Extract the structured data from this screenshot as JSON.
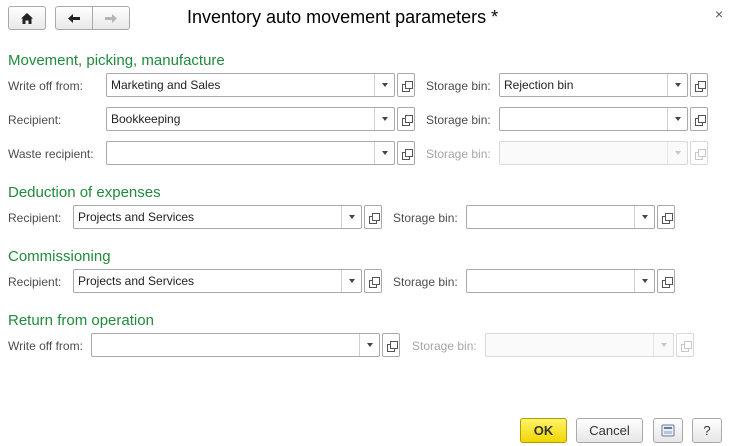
{
  "window": {
    "title": "Inventory auto movement parameters *"
  },
  "icons": {
    "home": "home-icon",
    "back": "arrow-left-icon",
    "forward": "arrow-right-icon",
    "close": "close-icon",
    "open": "open-form-icon",
    "dropdown": "chevron-down-icon",
    "more": "settings-icon"
  },
  "close_glyph": "×",
  "sections": {
    "movement": {
      "heading": "Movement, picking, manufacture",
      "write_off_label": "Write off from:",
      "write_off_value": "Marketing and Sales",
      "write_off_bin_label": "Storage bin:",
      "write_off_bin_value": "Rejection bin",
      "recipient_label": "Recipient:",
      "recipient_value": "Bookkeeping",
      "recipient_bin_label": "Storage bin:",
      "recipient_bin_value": "",
      "waste_label": "Waste recipient:",
      "waste_value": "",
      "waste_bin_label": "Storage bin:",
      "waste_bin_value": ""
    },
    "deduction": {
      "heading": "Deduction of expenses",
      "recipient_label": "Recipient:",
      "recipient_value": "Projects and Services",
      "bin_label": "Storage bin:",
      "bin_value": ""
    },
    "commissioning": {
      "heading": "Commissioning",
      "recipient_label": "Recipient:",
      "recipient_value": "Projects and Services",
      "bin_label": "Storage bin:",
      "bin_value": ""
    },
    "return": {
      "heading": "Return from operation",
      "write_off_label": "Write off from:",
      "write_off_value": "",
      "bin_label": "Storage bin:",
      "bin_value": ""
    }
  },
  "footer": {
    "ok_label": "OK",
    "cancel_label": "Cancel",
    "help_label": "?"
  }
}
